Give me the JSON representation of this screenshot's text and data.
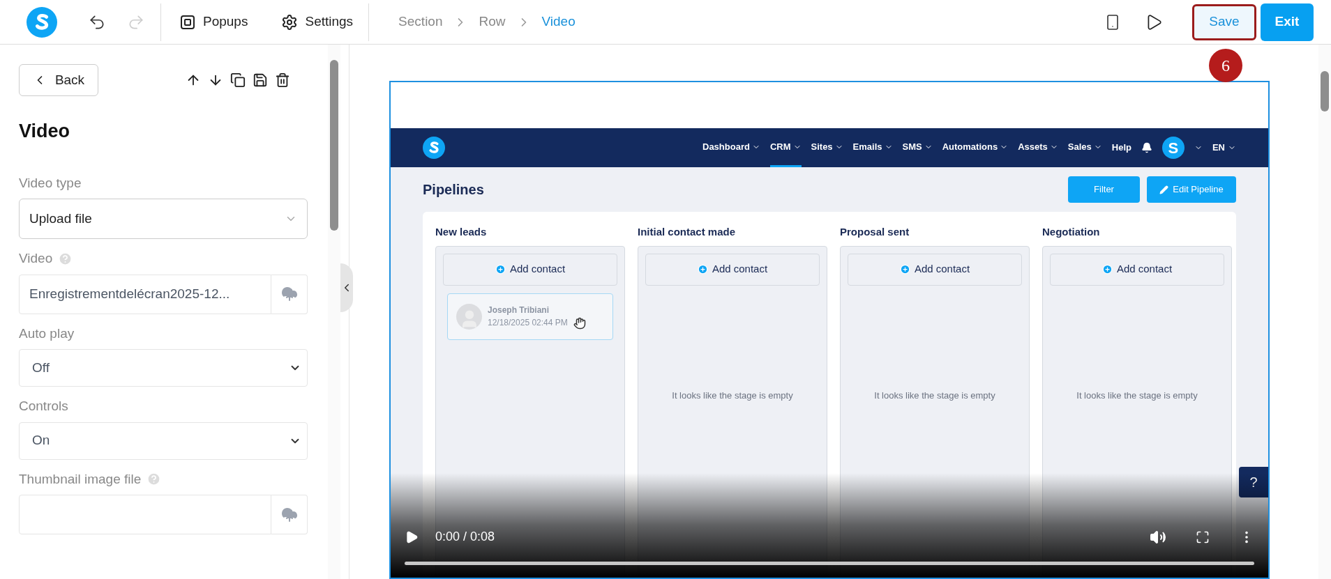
{
  "toolbar": {
    "popups": "Popups",
    "settings": "Settings",
    "breadcrumb": [
      {
        "label": "Section",
        "selected": false
      },
      {
        "label": "Row",
        "selected": false
      },
      {
        "label": "Video",
        "selected": true
      }
    ],
    "save": "Save",
    "exit": "Exit",
    "step_badge": "6"
  },
  "panel": {
    "back": "Back",
    "title": "Video",
    "fields": [
      {
        "kind": "select",
        "label": "Video type",
        "value": "Upload file",
        "help": false
      },
      {
        "kind": "upload",
        "label": "Video",
        "value": "Enregistrementdelécran2025-12...",
        "help": true
      },
      {
        "kind": "native",
        "label": "Auto play",
        "value": "Off",
        "help": false
      },
      {
        "kind": "native",
        "label": "Controls",
        "value": "On",
        "help": false
      },
      {
        "kind": "upload",
        "label": "Thumbnail image file",
        "help": true
      }
    ]
  },
  "video_frame": {
    "nav": [
      {
        "label": "Dashboard",
        "selected": false
      },
      {
        "label": "CRM",
        "selected": true
      },
      {
        "label": "Sites",
        "selected": false
      },
      {
        "label": "Emails",
        "selected": false
      },
      {
        "label": "SMS",
        "selected": false
      },
      {
        "label": "Automations",
        "selected": false
      },
      {
        "label": "Assets",
        "selected": false
      },
      {
        "label": "Sales",
        "selected": false
      }
    ],
    "help": "Help",
    "avatar_letter": "S",
    "language": "EN",
    "page_title": "Pipelines",
    "filter": "Filter",
    "edit_pipeline": "Edit Pipeline",
    "stages": [
      {
        "title": "New leads",
        "add": "Add contact",
        "cards": [
          {
            "name": "Joseph Tribiani",
            "date": "12/18/2025 02:44 PM"
          }
        ]
      },
      {
        "title": "Initial contact made",
        "add": "Add contact",
        "empty": "It looks like the stage is empty"
      },
      {
        "title": "Proposal sent",
        "add": "Add contact",
        "empty": "It looks like the stage is empty"
      },
      {
        "title": "Negotiation",
        "add": "Add contact",
        "empty": "It looks like the stage is empty"
      }
    ],
    "help_button": "?"
  },
  "player": {
    "time": "0:00 / 0:08"
  }
}
